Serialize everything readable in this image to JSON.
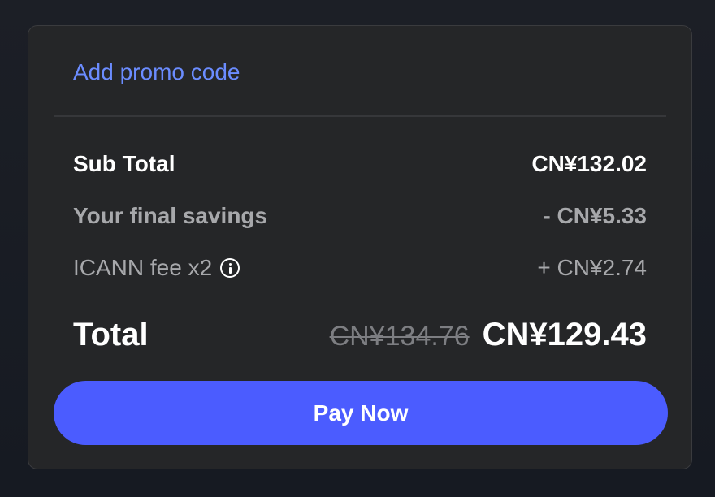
{
  "promo": {
    "link_label": "Add promo code"
  },
  "summary": {
    "subtotal_label": "Sub Total",
    "subtotal_value": "CN¥132.02",
    "savings_label": "Your final savings",
    "savings_value": "- CN¥5.33",
    "fee_label": "ICANN fee x2",
    "fee_value": "+ CN¥2.74",
    "fee_icon": "info-icon"
  },
  "total": {
    "label": "Total",
    "original_value": "CN¥134.76",
    "final_value": "CN¥129.43"
  },
  "actions": {
    "pay_label": "Pay Now"
  },
  "colors": {
    "accent": "#4b5cff",
    "link": "#6b8cff",
    "card_bg": "#252628",
    "muted_text": "#a7a8ab"
  }
}
